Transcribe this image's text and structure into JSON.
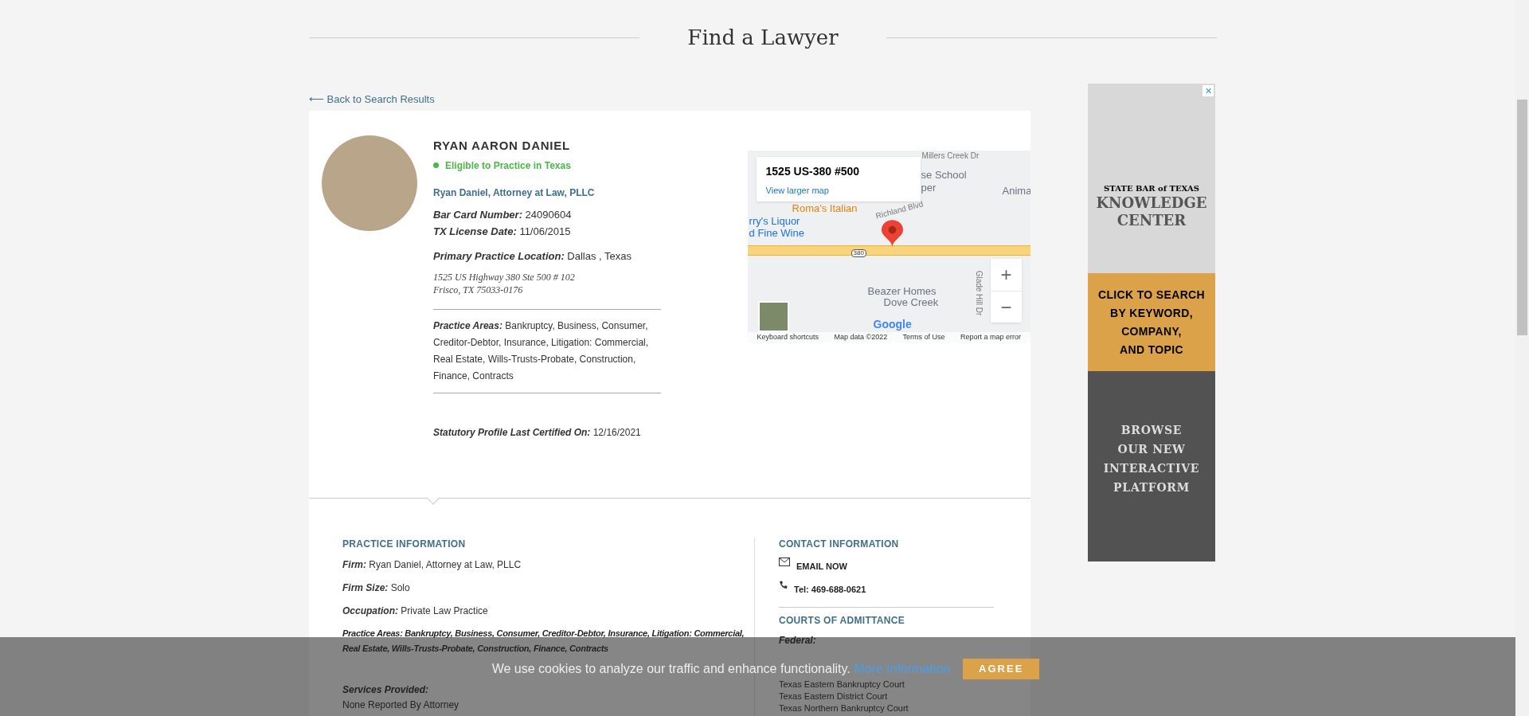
{
  "page_title": "Find a Lawyer",
  "back_link": "⟵ Back to Search Results",
  "profile": {
    "name": "RYAN AARON DANIEL",
    "status": {
      "text": "Eligible to Practice in Texas",
      "color": "#4cb648"
    },
    "firm_link": "Ryan Daniel, Attorney at Law, PLLC",
    "details": [
      {
        "label": "Bar Card Number:",
        "value": "24090604"
      },
      {
        "label": "TX License Date:",
        "value": "11/06/2015"
      }
    ],
    "location": {
      "label": "Primary Practice Location:",
      "value": "Dallas , Texas"
    },
    "address": [
      "1525 US Highway 380 Ste 500 # 102",
      "Frisco, TX 75033-0176"
    ],
    "practice_areas": {
      "label": "Practice Areas:",
      "value": "Bankruptcy, Business, Consumer, Creditor-Debtor, Insurance, Litigation: Commercial, Real Estate, Wills-Trusts-Probate, Construction, Finance, Contracts"
    },
    "certified": {
      "label": "Statutory Profile Last Certified On:",
      "value": "12/16/2021"
    }
  },
  "map": {
    "place_title": "1525 US-380 #500",
    "larger_link": "View larger map",
    "labels": [
      {
        "text": "Millers Creek Dr",
        "kind": "street"
      },
      {
        "text": "se School",
        "kind": "poi"
      },
      {
        "text": "per",
        "kind": "poi"
      },
      {
        "text": "Anima",
        "kind": "poi"
      },
      {
        "text": "Roma's Italian",
        "kind": "food"
      },
      {
        "text": "Richland Blvd",
        "kind": "street"
      },
      {
        "text": "rry's Liquor",
        "kind": "shop"
      },
      {
        "text": "d Fine Wine",
        "kind": "shop"
      },
      {
        "text": "380",
        "kind": "shield"
      },
      {
        "text": "Beazer Homes",
        "kind": "poi"
      },
      {
        "text": "Dove Creek",
        "kind": "poi"
      },
      {
        "text": "Glade Hill Dr",
        "kind": "vstreet"
      }
    ],
    "zoom_in": "+",
    "zoom_out": "−",
    "logo": "Google",
    "footer": [
      "Keyboard shortcuts",
      "Map data ©2022",
      "Terms of Use",
      "Report a map error"
    ]
  },
  "ad": {
    "close": "✕",
    "brand": "STATE BAR of TEXAS",
    "title": [
      "KNOWLEDGE",
      "CENTER"
    ],
    "cta": [
      "CLICK TO SEARCH",
      "BY KEYWORD,",
      "COMPANY,",
      "AND TOPIC"
    ],
    "browse": [
      "BROWSE",
      "OUR NEW",
      "INTERACTIVE",
      "PLATFORM"
    ]
  },
  "practice_information": {
    "heading": "PRACTICE INFORMATION",
    "fields": [
      {
        "label": "Firm:",
        "value": "Ryan Daniel, Attorney at Law, PLLC"
      },
      {
        "label": "Firm Size:",
        "value": "Solo"
      },
      {
        "label": "Occupation:",
        "value": "Private Law Practice"
      },
      {
        "label": "Practice Areas:",
        "value": "Bankruptcy, Business, Consumer, Creditor-Debtor, Insurance, Litigation: Commercial, Real Estate, Wills-Trusts-Probate, Construction, Finance, Contracts"
      }
    ],
    "services": {
      "label": "Services Provided:",
      "value": "None Reported By Attorney"
    }
  },
  "contact_information": {
    "heading": "CONTACT INFORMATION",
    "items": [
      {
        "kind": "email",
        "text": "EMAIL NOW"
      },
      {
        "kind": "phone",
        "text": "Tel: 469-688-0621"
      }
    ]
  },
  "courts": {
    "heading": "COURTS OF ADMITTANCE",
    "group": "Federal:",
    "items": [
      "Texas Eastern Bankruptcy Court",
      "Texas Eastern District Court",
      "Texas Northern Bankruptcy Court"
    ]
  },
  "cookie_bar": {
    "text": "We use cookies to analyze our traffic and enhance functionality.",
    "link": "More Information",
    "button": "AGREE"
  }
}
